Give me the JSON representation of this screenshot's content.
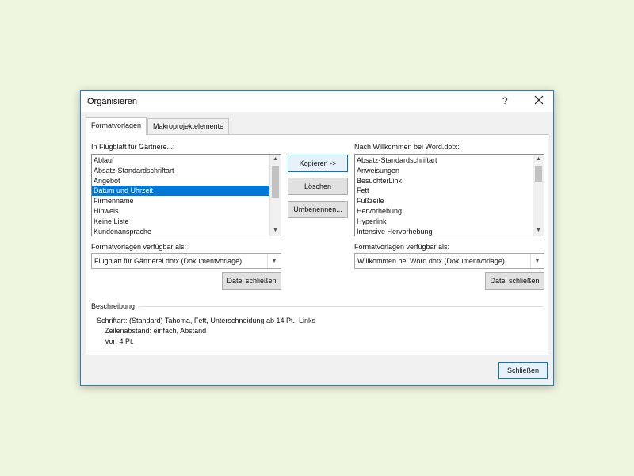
{
  "dialog": {
    "title": "Organisieren",
    "help_label": "?",
    "close_label": "Schließen"
  },
  "tabs": [
    {
      "label": "Formatvorlagen",
      "active": true
    },
    {
      "label": "Makroprojektelemente",
      "active": false
    }
  ],
  "left": {
    "list_label": "In Flugblatt für Gärtnere...:",
    "items": [
      "Ablauf",
      "Absatz-Standardschriftart",
      "Angebot",
      "Datum und Uhrzeit",
      "Firmenname",
      "Hinweis",
      "Keine Liste",
      "Kundenansprache"
    ],
    "selected_index": 3,
    "available_label": "Formatvorlagen verfügbar als:",
    "available_value": "Flugblatt für Gärtnerei.dotx (Dokumentvorlage)",
    "close_file_label": "Datei schließen"
  },
  "right": {
    "list_label": "Nach Willkommen bei Word.dotx:",
    "items": [
      "Absatz-Standardschriftart",
      "Anweisungen",
      "BesuchterLink",
      "Fett",
      "Fußzeile",
      "Hervorhebung",
      "Hyperlink",
      "Intensive Hervorhebung"
    ],
    "available_label": "Formatvorlagen verfügbar als:",
    "available_value": "Willkommen bei Word.dotx (Dokumentvorlage)",
    "close_file_label": "Datei schließen"
  },
  "actions": {
    "copy_label": "Kopieren ->",
    "delete_label": "Löschen",
    "rename_label": "Umbenennen..."
  },
  "description": {
    "heading": "Beschreibung",
    "line1": "Schriftart: (Standard) Tahoma, Fett, Unterschneidung ab 14 Pt., Links",
    "line2": "Zeilenabstand:  einfach, Abstand",
    "line3": "Vor:  4 Pt."
  },
  "colors": {
    "selection": "#0078d7",
    "dialog_border": "#2b78d0",
    "background": "#eef6e0"
  }
}
